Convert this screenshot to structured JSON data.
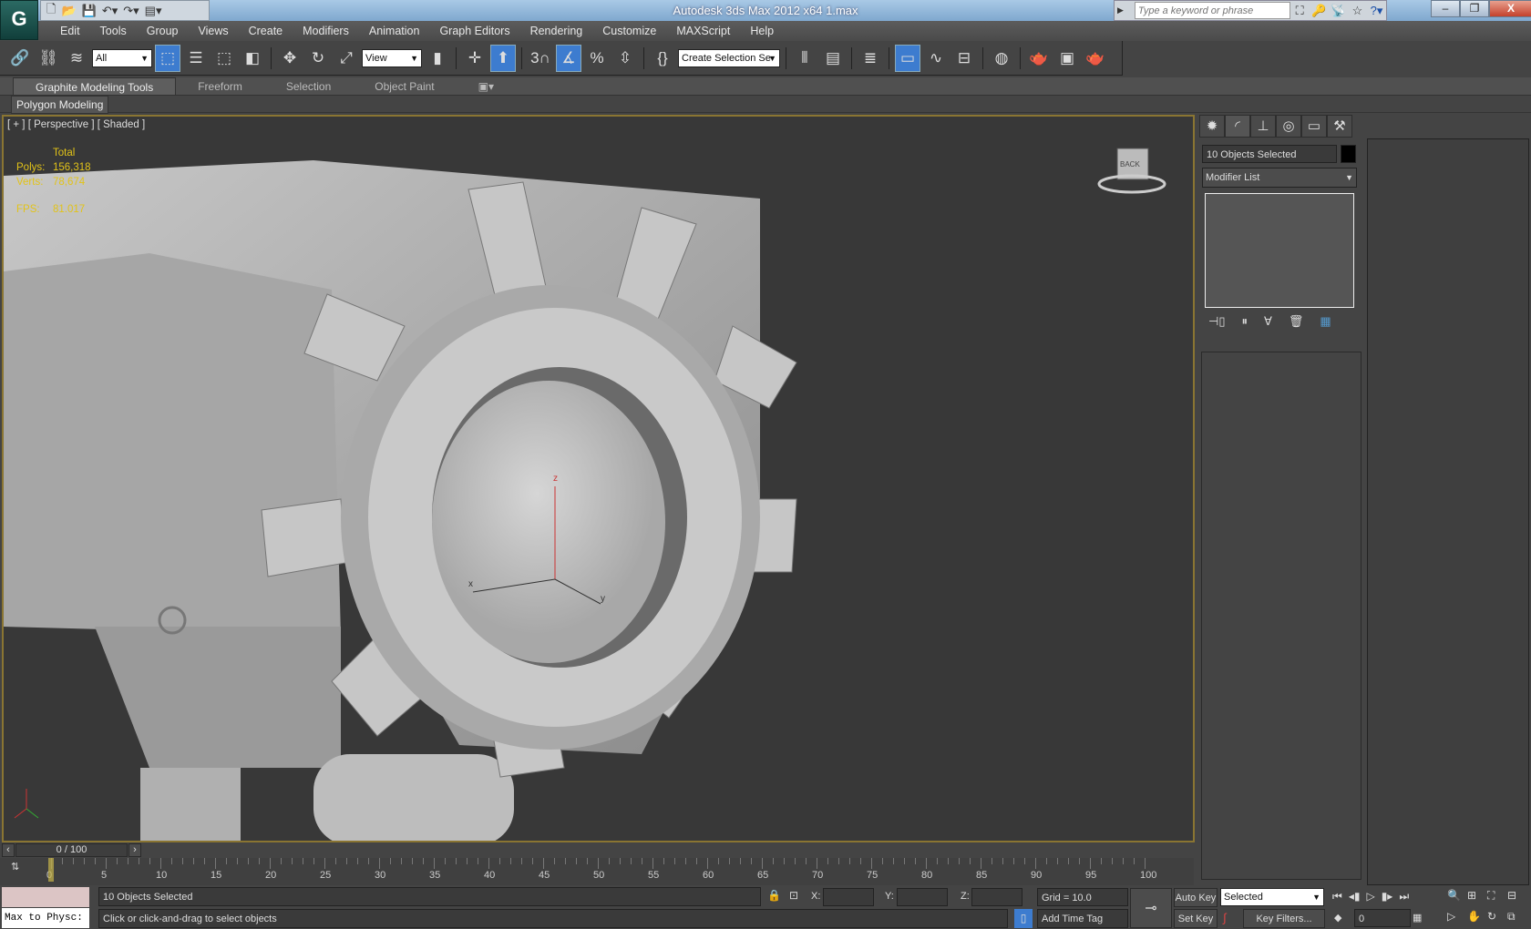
{
  "titlebar": {
    "title": "Autodesk 3ds Max  2012 x64      1.max",
    "search_placeholder": "Type a keyword or phrase",
    "app_button": "G"
  },
  "menu": [
    "Edit",
    "Tools",
    "Group",
    "Views",
    "Create",
    "Modifiers",
    "Animation",
    "Graph Editors",
    "Rendering",
    "Customize",
    "MAXScript",
    "Help"
  ],
  "toolbar": {
    "selection_filter": "All",
    "ref_coord": "View",
    "snap_angle_label": "3",
    "named_selection": "Create Selection Se"
  },
  "ribbon": {
    "tabs": [
      "Graphite Modeling Tools",
      "Freeform",
      "Selection",
      "Object Paint"
    ],
    "active_tab": "Graphite Modeling Tools",
    "panel": "Polygon Modeling"
  },
  "viewport": {
    "label": "[ + ] [ Perspective ] [ Shaded ]",
    "stats": {
      "header": "Total",
      "polys_label": "Polys:",
      "polys": "156,318",
      "verts_label": "Verts:",
      "verts": "78,674",
      "fps_label": "FPS:",
      "fps": "81.017"
    },
    "viewcube_face": "BACK",
    "gizmo": {
      "x": "x",
      "y": "y",
      "z": "z"
    }
  },
  "command_panel": {
    "object_name": "10 Objects Selected",
    "modifier_list": "Modifier List",
    "tabs": [
      "create",
      "modify",
      "hierarchy",
      "motion",
      "display",
      "utilities"
    ]
  },
  "timeline": {
    "slider": "0 / 100",
    "current_frame": 0,
    "start": 0,
    "end": 100,
    "ticks": [
      "0",
      "5",
      "10",
      "15",
      "20",
      "25",
      "30",
      "35",
      "40",
      "45",
      "50",
      "55",
      "60",
      "65",
      "70",
      "75",
      "80",
      "85",
      "90",
      "95",
      "100"
    ]
  },
  "status": {
    "listener": "Max to Physc:",
    "selection": "10 Objects Selected",
    "prompt": "Click or click-and-drag to select objects",
    "x_label": "X:",
    "y_label": "Y:",
    "z_label": "Z:",
    "grid": "Grid = 10.0",
    "add_time_tag": "Add Time Tag",
    "auto_key": "Auto Key",
    "set_key": "Set Key",
    "key_mode": "Selected",
    "key_filters": "Key Filters...",
    "frame": "0"
  },
  "colors": {
    "viewport_border": "#8a7532",
    "stats": "#e2c318",
    "active_button": "#3d7ccf"
  }
}
